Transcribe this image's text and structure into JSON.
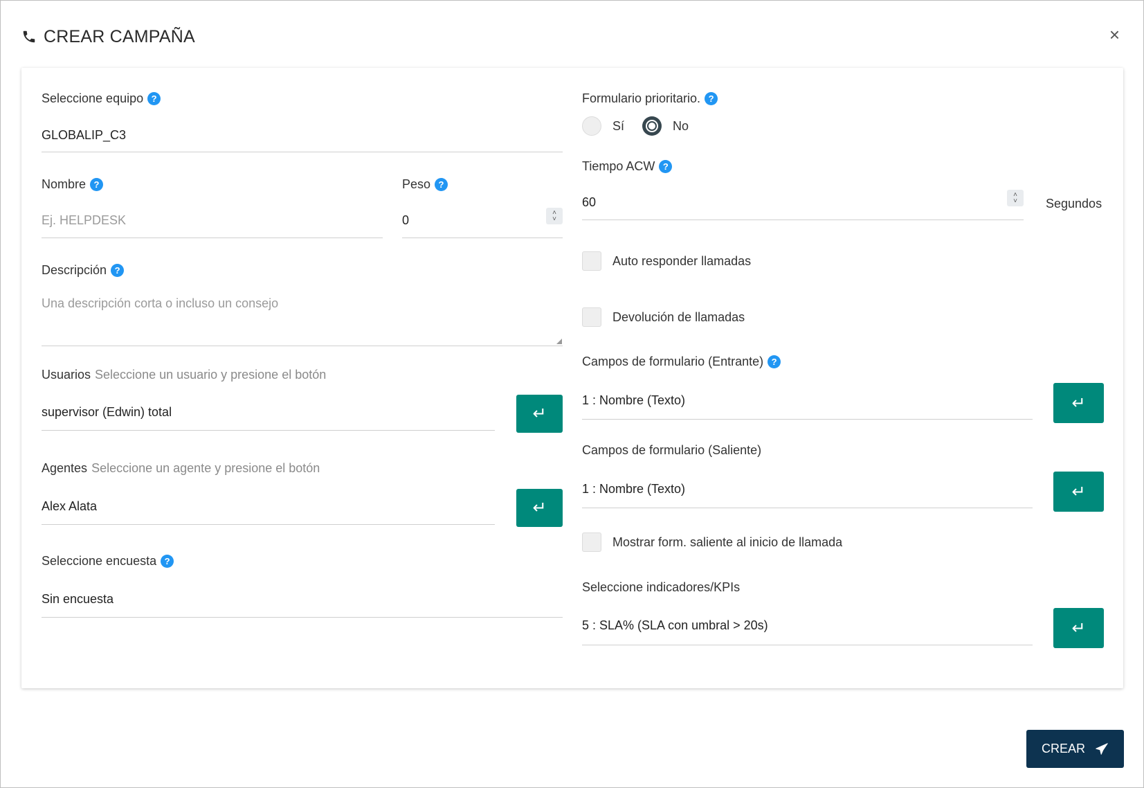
{
  "header": {
    "title": "CREAR CAMPAÑA",
    "phone_icon": "phone-icon",
    "close": "×"
  },
  "left": {
    "equipo": {
      "label": "Seleccione equipo",
      "value": "GLOBALIP_C3"
    },
    "nombre": {
      "label": "Nombre",
      "placeholder": "Ej. HELPDESK"
    },
    "peso": {
      "label": "Peso",
      "value": "0"
    },
    "descripcion": {
      "label": "Descripción",
      "placeholder": "Una descripción corta o incluso un consejo"
    },
    "usuarios": {
      "label": "Usuarios",
      "hint": "Seleccione un usuario y presione el botón",
      "value": "supervisor (Edwin) total"
    },
    "agentes": {
      "label": "Agentes",
      "hint": "Seleccione un agente y presione el botón",
      "value": "Alex Alata"
    },
    "encuesta": {
      "label": "Seleccione encuesta",
      "value": "Sin encuesta"
    }
  },
  "right": {
    "prioritario": {
      "label": "Formulario prioritario.",
      "options": [
        "Sí",
        "No"
      ],
      "selected": "No"
    },
    "acw": {
      "label": "Tiempo ACW",
      "value": "60",
      "unit": "Segundos"
    },
    "auto_responder": {
      "label": "Auto responder llamadas",
      "checked": false
    },
    "devolucion": {
      "label": "Devolución de llamadas",
      "checked": false
    },
    "entrante": {
      "label": "Campos de formulario (Entrante)",
      "value": "1 : Nombre (Texto)"
    },
    "saliente": {
      "label": "Campos de formulario (Saliente)",
      "value": "1 : Nombre (Texto)"
    },
    "mostrar": {
      "label": "Mostrar form. saliente al inicio de llamada",
      "checked": false
    },
    "kpis": {
      "label": "Seleccione indicadores/KPIs",
      "value": "5 : SLA% (SLA con umbral > 20s)"
    }
  },
  "footer": {
    "submit_label": "CREAR"
  },
  "colors": {
    "accent": "#00897b",
    "help": "#2196f3",
    "primary": "#0d3350"
  }
}
